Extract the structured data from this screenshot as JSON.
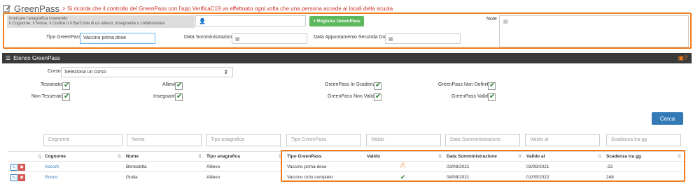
{
  "header": {
    "title": "GreenPass",
    "note": "> Si ricorda che il controllo del GreenPass con l'app VerificaC19 va effettuato ogni volta che una persona accede ai locali della scuola"
  },
  "search": {
    "help_line1": "ricercare l'anagrafica inserendo",
    "help_line2": "il Cognome, il Nome, il Codice o il BarCode di un allievo, insegnante o collaboratore",
    "register_label": "+ Registra GreenPass",
    "note_label": "Note"
  },
  "form": {
    "tipo_label": "Tipo GreenPass",
    "tipo_value": "Vaccino prima dose",
    "data_somm_label": "Data Somministrazione",
    "data_app_label": "Data Appuntamento Seconda Dose"
  },
  "elenco": {
    "title": "Elenco GreenPass",
    "corso_label": "Corso",
    "corso_value": "Seleziona un corso",
    "checks": {
      "tesserato": "Tesserato",
      "non_tesserato": "Non Tesserato",
      "allievi": "Allievi",
      "insegnanti": "Insegnanti",
      "in_scadenza": "GreenPass In Scadenza",
      "non_valido": "GreenPass Non Valido",
      "non_definito": "GreenPass Non Definito",
      "valido": "GreenPass Valido"
    },
    "cerca_label": "Cerca"
  },
  "table": {
    "filters": [
      "Cognome",
      "Nome",
      "Tipo anagrafica",
      "Tipo GreenPass",
      "Valido",
      "Data Somministrazione",
      "Valido al",
      "Scadenza tra gg"
    ],
    "headers": [
      "Cognome",
      "Nome",
      "Tipo anagrafica",
      "Tipo GreenPass",
      "Valido",
      "Data Somministrazione",
      "Valido al",
      "Scadenza tra gg"
    ],
    "rows": [
      {
        "cognome": "Accorti",
        "nome": "Benedetta",
        "tipo_anagrafica": "Allievo",
        "tipo_gp": "Vaccino prima dose",
        "valido": "warning",
        "data_somm": "03/08/2021",
        "valido_al": "03/08/2021",
        "scadenza": "-23"
      },
      {
        "cognome": "Ronco",
        "nome": "Giulia",
        "tipo_anagrafica": "Allievo",
        "tipo_gp": "Vaccino ciclo completo",
        "valido": "ok",
        "data_somm": "04/08/2021",
        "valido_al": "01/05/2022",
        "scadenza": "248"
      }
    ]
  }
}
